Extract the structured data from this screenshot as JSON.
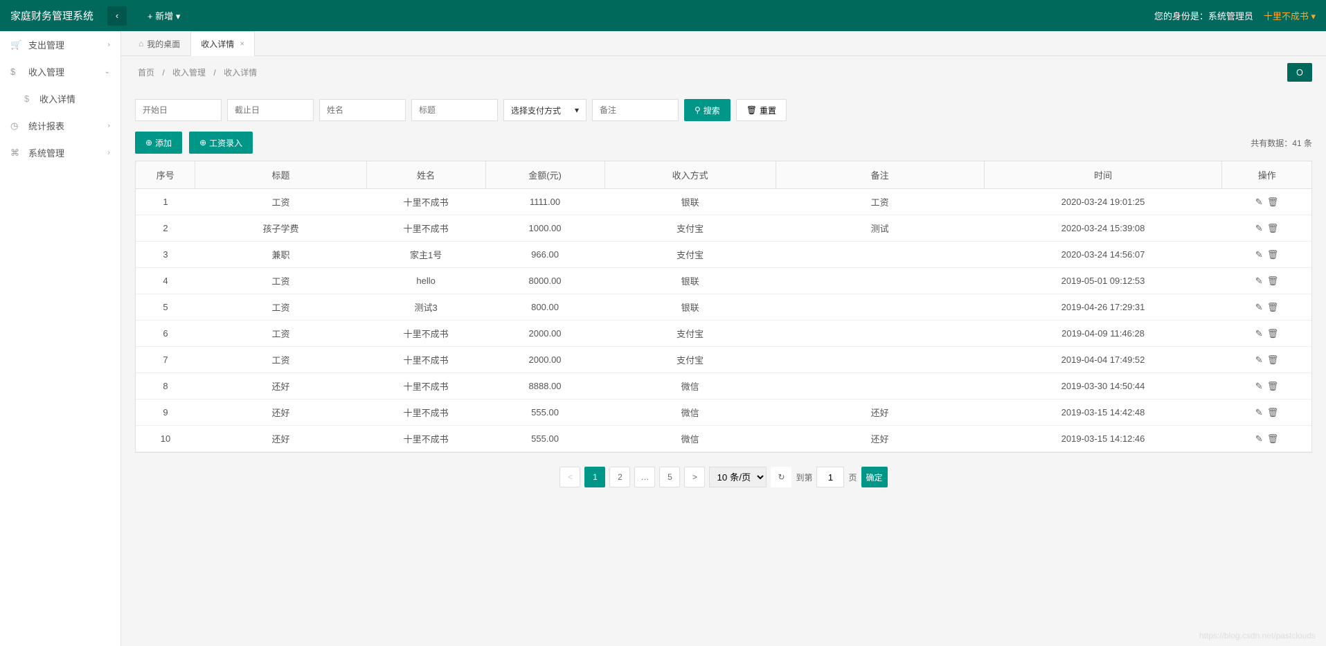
{
  "header": {
    "title": "家庭财务管理系统",
    "add_new": "+ 新增",
    "role_label": "您的身份是：系统管理员",
    "user": "十里不成书"
  },
  "sidebar": {
    "items": [
      {
        "label": "支出管理",
        "icon": "🛒",
        "arrow": "›"
      },
      {
        "label": "收入管理",
        "icon": "$",
        "arrow": "⌄",
        "expanded": true,
        "children": [
          {
            "label": "收入详情",
            "icon": "$"
          }
        ]
      },
      {
        "label": "统计报表",
        "icon": "◷",
        "arrow": "›"
      },
      {
        "label": "系统管理",
        "icon": "⌘",
        "arrow": "›"
      }
    ]
  },
  "tabs": [
    {
      "label": "我的桌面",
      "home": true,
      "closable": false
    },
    {
      "label": "收入详情",
      "active": true,
      "closable": true
    }
  ],
  "breadcrumb": [
    "首页",
    "收入管理",
    "收入详情"
  ],
  "filters": {
    "start_date": "开始日",
    "end_date": "截止日",
    "name": "姓名",
    "title": "标题",
    "pay_method": "选择支付方式",
    "note": "备注",
    "search": "搜索",
    "reset": "重置"
  },
  "actions": {
    "add": "添加",
    "salary": "工资录入",
    "total_prefix": "共有数据：",
    "total_count": "41",
    "total_suffix": " 条"
  },
  "table": {
    "headers": [
      "序号",
      "标题",
      "姓名",
      "金额(元)",
      "收入方式",
      "备注",
      "时间",
      "操作"
    ],
    "rows": [
      [
        "1",
        "工资",
        "十里不成书",
        "1111.00",
        "银联",
        "工资",
        "2020-03-24 19:01:25"
      ],
      [
        "2",
        "孩子学费",
        "十里不成书",
        "1000.00",
        "支付宝",
        "测试",
        "2020-03-24 15:39:08"
      ],
      [
        "3",
        "兼职",
        "家主1号",
        "966.00",
        "支付宝",
        "",
        "2020-03-24 14:56:07"
      ],
      [
        "4",
        "工资",
        "hello",
        "8000.00",
        "银联",
        "",
        "2019-05-01 09:12:53"
      ],
      [
        "5",
        "工资",
        "测试3",
        "800.00",
        "银联",
        "",
        "2019-04-26 17:29:31"
      ],
      [
        "6",
        "工资",
        "十里不成书",
        "2000.00",
        "支付宝",
        "",
        "2019-04-09 11:46:28"
      ],
      [
        "7",
        "工资",
        "十里不成书",
        "2000.00",
        "支付宝",
        "",
        "2019-04-04 17:49:52"
      ],
      [
        "8",
        "还好",
        "十里不成书",
        "8888.00",
        "微信",
        "",
        "2019-03-30 14:50:44"
      ],
      [
        "9",
        "还好",
        "十里不成书",
        "555.00",
        "微信",
        "还好",
        "2019-03-15 14:42:48"
      ],
      [
        "10",
        "还好",
        "十里不成书",
        "555.00",
        "微信",
        "还好",
        "2019-03-15 14:12:46"
      ]
    ]
  },
  "pagination": {
    "pages": [
      "1",
      "2",
      "…",
      "5"
    ],
    "active": "1",
    "size": "10 条/页",
    "goto_label": "到第",
    "goto_value": "1",
    "page_label": "页",
    "confirm": "确定"
  },
  "watermark": "https://blog.csdn.net/pastclouds",
  "refresh_icon": "Ｏ"
}
